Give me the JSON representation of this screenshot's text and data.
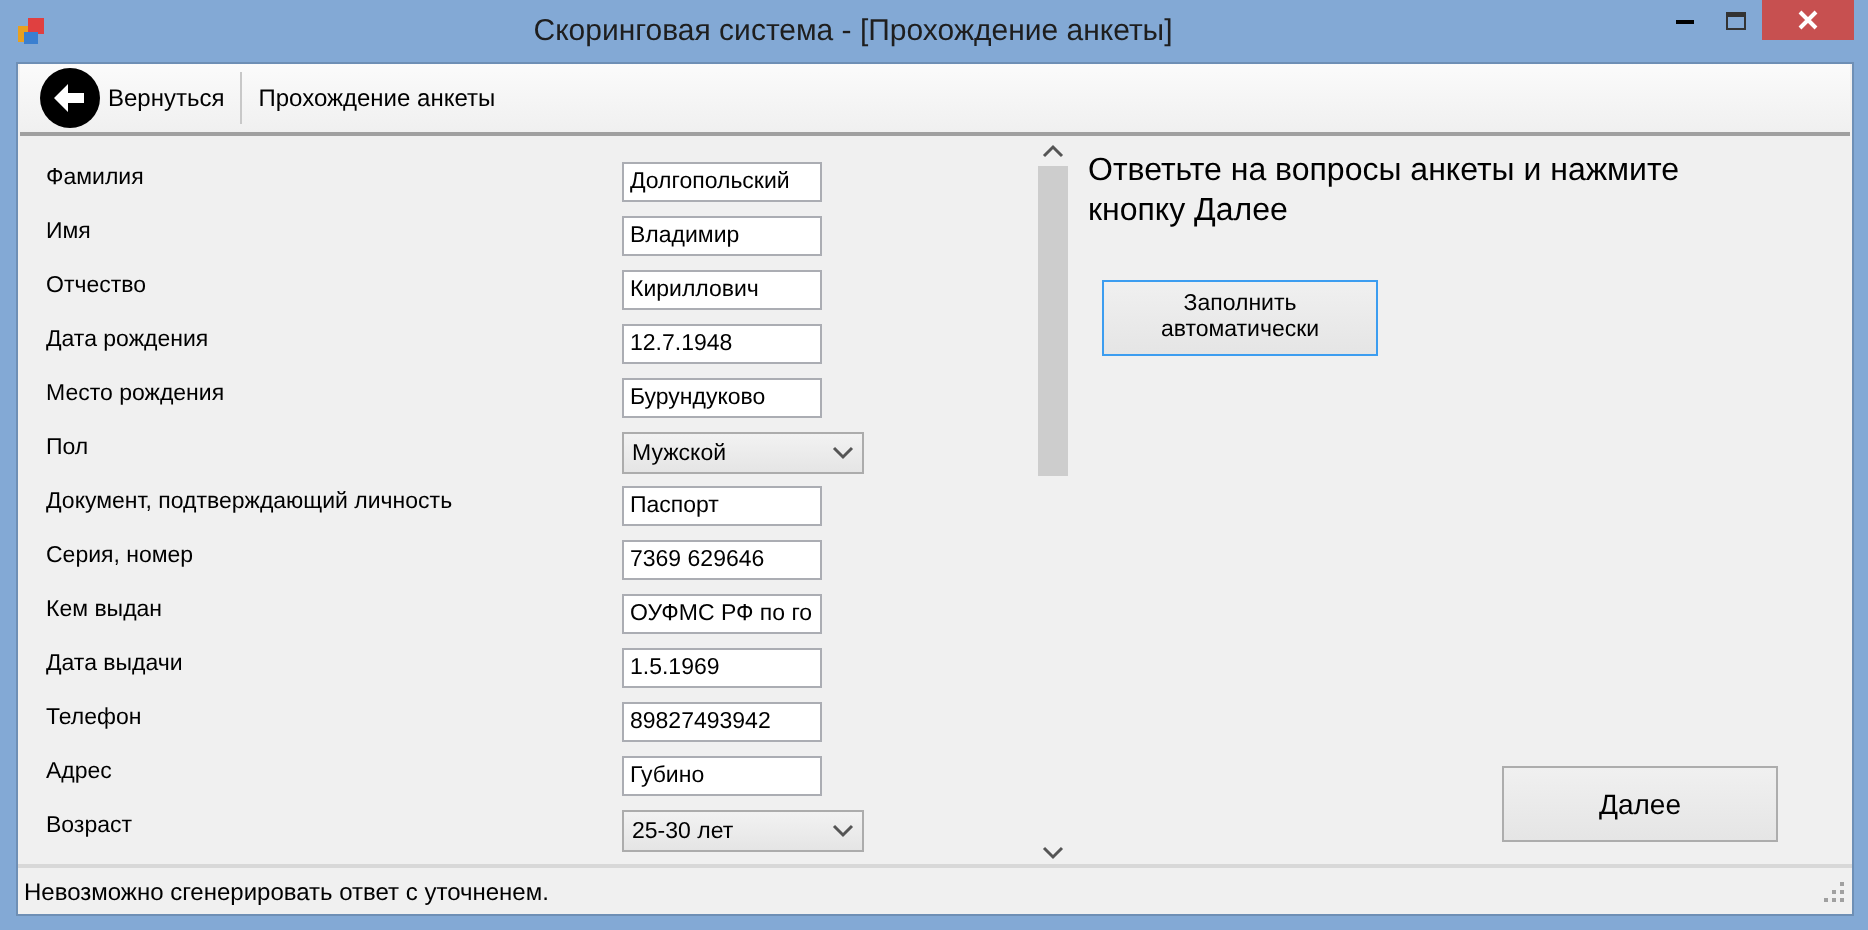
{
  "window": {
    "title": "Скоринговая система - [Прохождение анкеты]"
  },
  "toolbar": {
    "back_button": "Вернуться",
    "caption": "Прохождение анкеты"
  },
  "form": {
    "fields": [
      {
        "kind": "text",
        "label": "Фамилия",
        "value": "Долгопольский"
      },
      {
        "kind": "text",
        "label": "Имя",
        "value": "Владимир"
      },
      {
        "kind": "text",
        "label": "Отчество",
        "value": "Кириллович"
      },
      {
        "kind": "text",
        "label": "Дата рождения",
        "value": "12.7.1948"
      },
      {
        "kind": "text",
        "label": "Место рождения",
        "value": "Бурундуково"
      },
      {
        "kind": "select",
        "label": "Пол",
        "value": "Мужской"
      },
      {
        "kind": "text",
        "label": "Документ, подтверждающий личность",
        "value": "Паспорт"
      },
      {
        "kind": "text",
        "label": "Серия, номер",
        "value": "7369 629646"
      },
      {
        "kind": "text",
        "label": "Кем выдан",
        "value": "ОУФМС РФ по го"
      },
      {
        "kind": "text",
        "label": "Дата выдачи",
        "value": "1.5.1969"
      },
      {
        "kind": "text",
        "label": "Телефон",
        "value": "89827493942"
      },
      {
        "kind": "text",
        "label": "Адрес",
        "value": "Губино"
      },
      {
        "kind": "select",
        "label": "Возраст",
        "value": "25-30 лет"
      }
    ]
  },
  "instructions": "Ответьте на вопросы анкеты и нажмите кнопку Далее",
  "autofill_button": "Заполнить автоматически",
  "next_button": "Далее",
  "status_bar": "Невозможно сгенерировать ответ с уточненем."
}
